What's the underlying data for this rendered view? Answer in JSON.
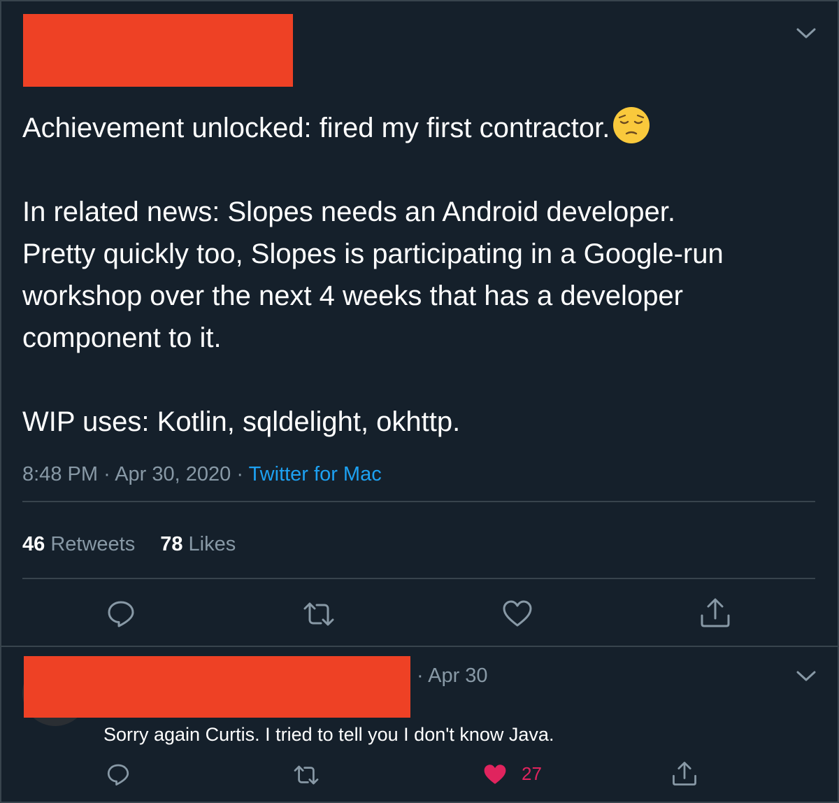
{
  "tweet": {
    "text_line_1": "Achievement unlocked: fired my first contractor.",
    "emoji": "pensive-face-emoji",
    "text_para_2": [
      "In related news: Slopes needs an Android developer.",
      "Pretty quickly too, Slopes is participating in a Google-run",
      "workshop over the next 4 weeks that has a developer",
      "component to it."
    ],
    "text_para_3": "WIP uses: Kotlin, sqldelight, okhttp.",
    "time": "8:48 PM",
    "date": "Apr 30, 2020",
    "separator": "·",
    "source": "Twitter for Mac",
    "retweets_count": "46",
    "retweets_label": "Retweets",
    "likes_count": "78",
    "likes_label": "Likes"
  },
  "reply": {
    "date": "· Apr 30",
    "text": "Sorry again Curtis. I tried to tell you I don't know Java.",
    "likes": "27"
  },
  "colors": {
    "background": "#15202b",
    "divider": "#38444d",
    "muted": "#8899a6",
    "link": "#1da1f2",
    "like": "#e0245e",
    "redaction": "#ee4125"
  },
  "icons": [
    "chevron-down-icon",
    "reply-icon",
    "retweet-icon",
    "like-icon",
    "share-icon"
  ]
}
